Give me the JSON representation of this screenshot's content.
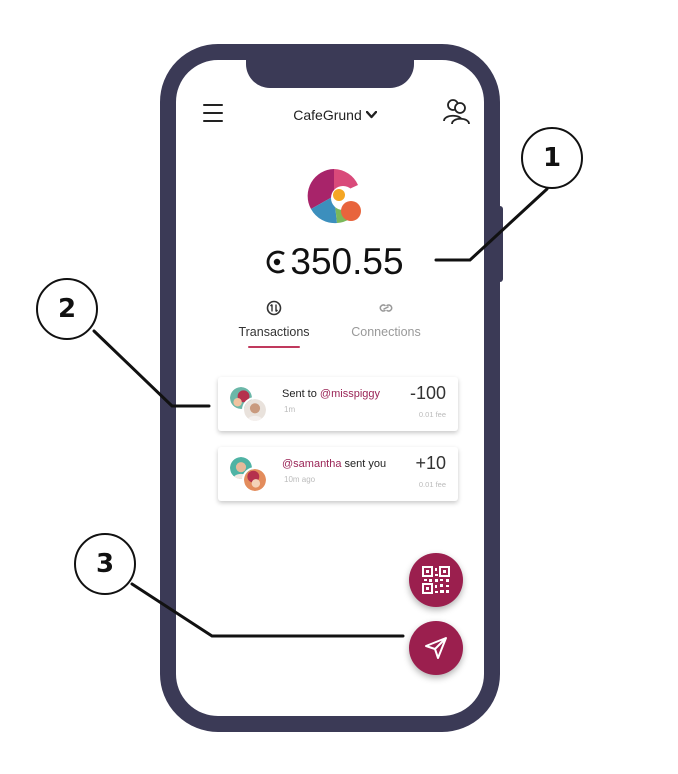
{
  "header": {
    "account_name": "CafeGrund",
    "account_chevron": "❯"
  },
  "balance": {
    "amount": "350.55"
  },
  "tabs": [
    {
      "label": "Transactions",
      "active": true
    },
    {
      "label": "Connections",
      "active": false
    }
  ],
  "transactions": [
    {
      "prefix": "Sent to ",
      "handle": "@misspiggy",
      "suffix": "",
      "time": "1m",
      "amount": "-100",
      "fee": "0.01 fee"
    },
    {
      "prefix": "",
      "handle": "@samantha",
      "suffix": " sent you",
      "time": "10m ago",
      "amount": "+10",
      "fee": "0.01 fee"
    }
  ],
  "actions": {
    "qr_icon": "qr-code-icon",
    "send_icon": "paper-plane-icon"
  },
  "callouts": [
    "1",
    "2",
    "3"
  ],
  "colors": {
    "phone_frame": "#3b3a56",
    "accent": "#9b1f4e",
    "handle": "#9a2456",
    "tab_underline": "#c0395d"
  }
}
